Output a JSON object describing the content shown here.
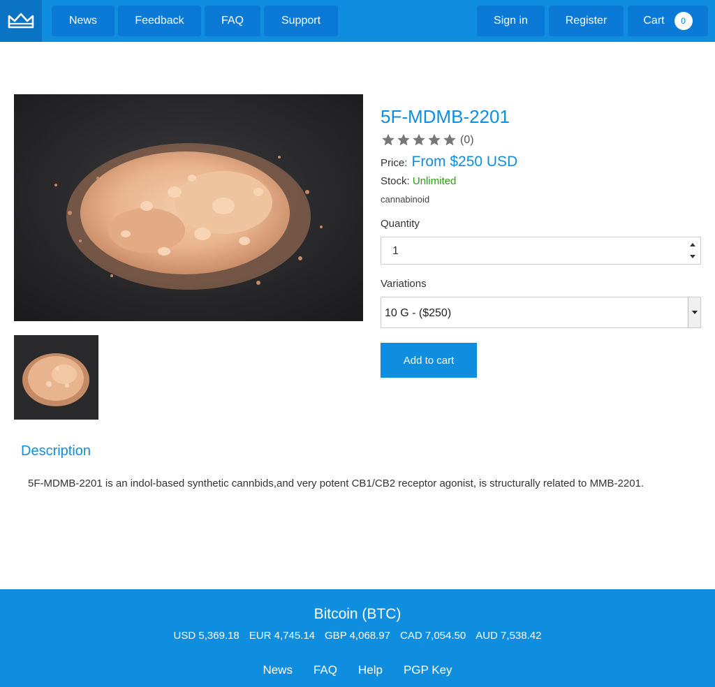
{
  "nav": {
    "items": [
      "News",
      "Feedback",
      "FAQ",
      "Support"
    ],
    "sign_in": "Sign in",
    "register": "Register",
    "cart_label": "Cart",
    "cart_count": "0"
  },
  "product": {
    "title": "5F-MDMB-2201",
    "rating_count": "(0)",
    "rating_stars": 5,
    "price_label": "Price:",
    "price_value": "From $250 USD",
    "stock_label": "Stock:",
    "stock_value": "Unlimited",
    "category": "cannabinoid",
    "quantity_label": "Quantity",
    "quantity_value": "1",
    "variations_label": "Variations",
    "variation_selected": "10 G - ($250)",
    "add_to_cart": "Add to cart"
  },
  "description": {
    "heading": "Description",
    "text": "5F-MDMB-2201 is an indol-based synthetic cannbids,and very potent CB1/CB2 receptor agonist, is structurally related to MMB-2201."
  },
  "footer": {
    "btc_title": "Bitcoin (BTC)",
    "rates": [
      "USD 5,369.18",
      "EUR 4,745.14",
      "GBP 4,068.97",
      "CAD 7,054.50",
      "AUD 7,538.42"
    ],
    "links": [
      "News",
      "FAQ",
      "Help",
      "PGP Key"
    ]
  },
  "colors": {
    "brand_blue": "#0f8ee0",
    "nav_button": "#0a7ad6",
    "stock_green": "#2e9b0e",
    "powder": "#e8b892"
  },
  "icons": {
    "logo": "crown-icon",
    "rating": "star-icon"
  }
}
